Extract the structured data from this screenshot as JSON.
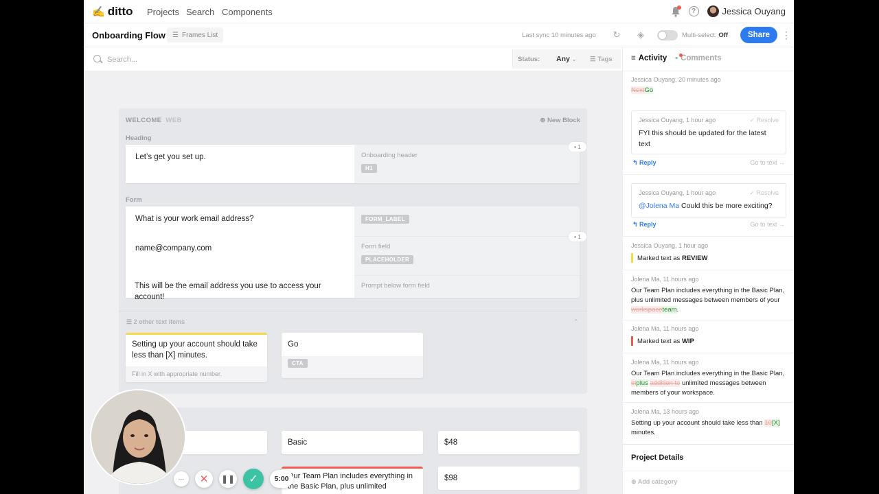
{
  "nav": {
    "logo": "ditto",
    "links": [
      "Projects",
      "Search",
      "Components"
    ],
    "user": "Jessica Ouyang"
  },
  "subbar": {
    "title": "Onboarding Flow",
    "frames_list": "Frames List",
    "last_sync": "Last sync 10 minutes ago",
    "multiselect_label": "Multi-select:",
    "multiselect_value": "Off",
    "share": "Share"
  },
  "search": {
    "placeholder": "Search...",
    "status_label": "Status:",
    "status_value": "Any",
    "tags_label": "Tags"
  },
  "frame1": {
    "name": "WELCOME",
    "platform": "WEB",
    "new_block": "New Block",
    "heading_section": "Heading",
    "heading_text": "Let’s get you set up.",
    "heading_note": "Onboarding header",
    "heading_tag": "H1",
    "heading_comments": "1",
    "form_section": "Form",
    "form_q": "What is your work email address?",
    "form_q_tag": "FORM_LABEL",
    "form_field": "name@company.com",
    "form_field_note": "Form field",
    "form_field_tag": "PLACEHOLDER",
    "form_comments": "1",
    "form_prompt": "This will be the email address you use to access your account!",
    "form_prompt_note": "Prompt below form field",
    "other_items": "2 other text items",
    "card1_text": "Setting up your account should take less than [X] minutes.",
    "card1_note": "Fill in X with appropriate number.",
    "card2_text": "Go",
    "card2_tag": "CTA"
  },
  "frame2": {
    "cell_basic": "Basic",
    "cell_price1": "$48",
    "cell_team_text": "Our Team Plan includes everything in the Basic Plan, plus unlimited",
    "cell_price2": "$98"
  },
  "recording": {
    "timer": "5:00",
    "more": "···"
  },
  "panel": {
    "tab_activity": "Activity",
    "tab_comments": "Comments",
    "e1_meta": "Jessica Ouyang, 20 minutes ago",
    "e1_del": "Next",
    "e1_ins": "Go",
    "c1_meta": "Jessica Ouyang, 1 hour ago",
    "c1_resolve": "✓ Resolve",
    "c1_text": "FYI this should be updated for the latest text",
    "c2_meta": "Jessica Ouyang, 1 hour ago",
    "c2_resolve": "✓ Resolve",
    "c2_mention": "@Jolena Ma",
    "c2_text": " Could this be more exciting?",
    "reply": "Reply",
    "goto": "Go to text →",
    "e2_meta": "Jessica Ouyang, 1 hour ago",
    "e2_text": "Marked text as ",
    "e2_status": "REVIEW",
    "e3_meta": "Jolena Ma, 11 hours ago",
    "e3_text1": "Our Team Plan includes everything in the Basic Plan, plus unlimited messages between members of your ",
    "e3_del": "workspace",
    "e3_ins": "team",
    "e3_end": ".",
    "e4_meta": "Jolena Ma, 11 hours ago",
    "e4_text": "Marked text as ",
    "e4_status": "WIP",
    "e5_meta": "Jolena Ma, 11 hours ago",
    "e5_text1": "Our Team Plan includes everything in the Basic Plan, ",
    "e5_del1": "in",
    "e5_ins1": "plus",
    "e5_del2": "addition to",
    "e5_text2": " unlimited messages between members of your workspace.",
    "e6_meta": "Jolena Ma, 13 hours ago",
    "e6_text1": "Setting up your account should take less than ",
    "e6_del": "10",
    "e6_ins": "[X]",
    "e6_text2": " minutes.",
    "project_details": "Project Details",
    "add_category": "⊕ Add category"
  },
  "colors": {
    "accent": "#2e7bef",
    "heading_bar": "#ef5b4c",
    "form_bar": "#7ed957",
    "review": "#f2d94e",
    "wip": "#ef5b4c",
    "check": "#3cc3a4"
  }
}
